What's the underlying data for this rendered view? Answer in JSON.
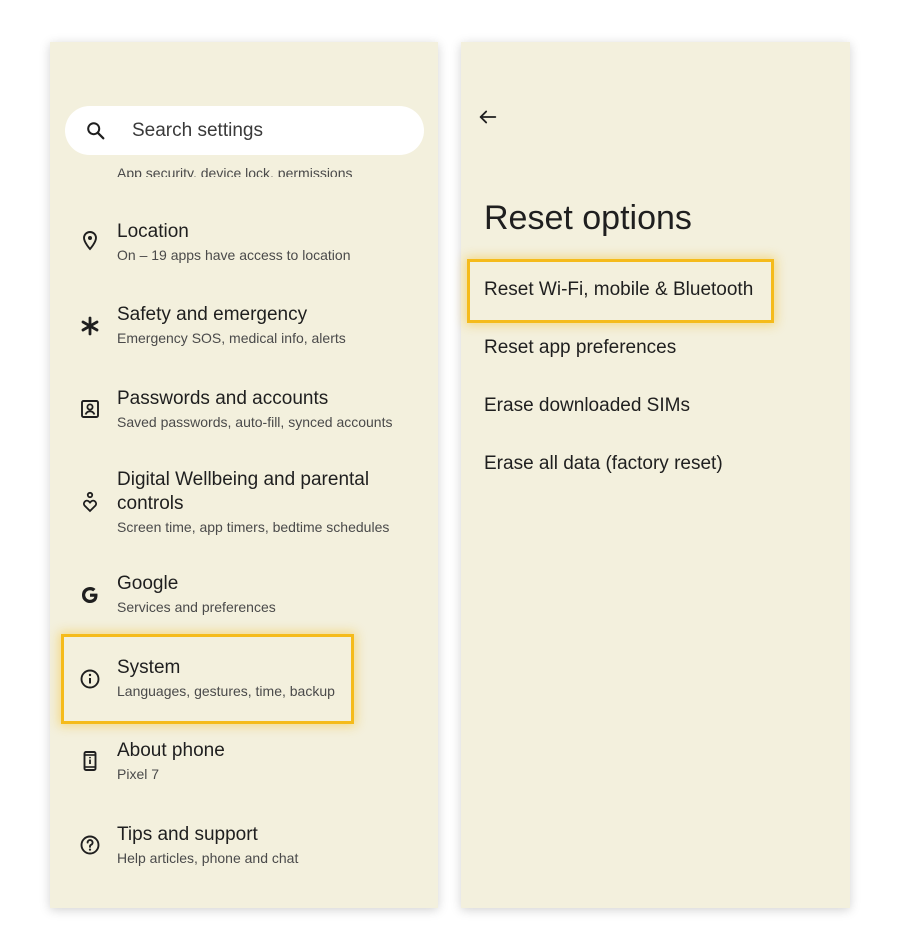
{
  "settings": {
    "search_placeholder": "Search settings",
    "partial_item_subtitle": "App security, device lock, permissions",
    "items": [
      {
        "title": "Location",
        "subtitle": "On – 19 apps have access to location",
        "icon": "location-pin-icon"
      },
      {
        "title": "Safety and emergency",
        "subtitle": "Emergency SOS, medical info, alerts",
        "icon": "asterisk-icon"
      },
      {
        "title": "Passwords and accounts",
        "subtitle": "Saved passwords, auto-fill, synced accounts",
        "icon": "account-box-icon"
      },
      {
        "title": "Digital Wellbeing and parental controls",
        "subtitle": "Screen time, app timers, bedtime schedules",
        "icon": "wellbeing-icon"
      },
      {
        "title": "Google",
        "subtitle": "Services and preferences",
        "icon": "google-g-icon"
      },
      {
        "title": "System",
        "subtitle": "Languages, gestures, time, backup",
        "icon": "info-icon"
      },
      {
        "title": "About phone",
        "subtitle": "Pixel 7",
        "icon": "phone-icon"
      },
      {
        "title": "Tips and support",
        "subtitle": "Help articles, phone and chat",
        "icon": "help-circle-icon"
      }
    ]
  },
  "reset": {
    "title": "Reset options",
    "options": [
      "Reset Wi-Fi, mobile & Bluetooth",
      "Reset app preferences",
      "Erase downloaded SIMs",
      "Erase all data (factory reset)"
    ]
  },
  "colors": {
    "panel_background": "#f3f0dd",
    "highlight": "#f5bb1b",
    "text_primary": "#1f1f1f",
    "text_secondary": "#4a4a4a"
  }
}
